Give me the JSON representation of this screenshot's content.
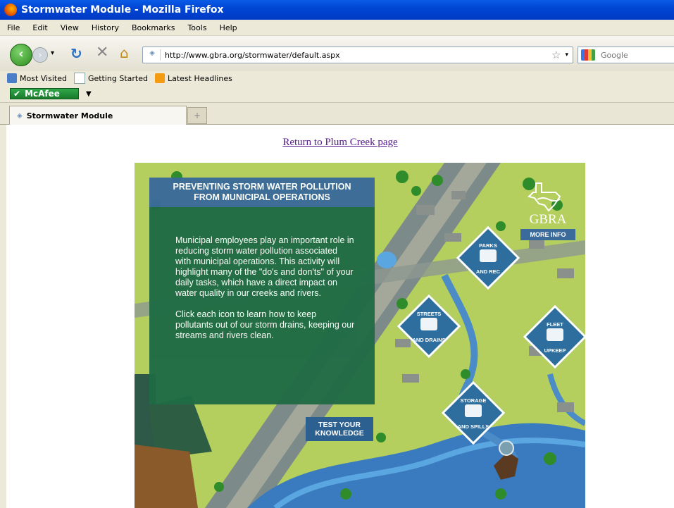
{
  "window": {
    "title": "Stormwater Module - Mozilla Firefox"
  },
  "menu": [
    "File",
    "Edit",
    "View",
    "History",
    "Bookmarks",
    "Tools",
    "Help"
  ],
  "address": {
    "url": "http://www.gbra.org/stormwater/default.aspx"
  },
  "search": {
    "placeholder": "Google"
  },
  "bookmarks": [
    "Most Visited",
    "Getting Started",
    "Latest Headlines"
  ],
  "toolbar": {
    "mcafee_label": "McAfee"
  },
  "tabs": [
    {
      "label": "Stormwater Module"
    }
  ],
  "page": {
    "return_link": "Return to Plum Creek page",
    "info_title_line1": "PREVENTING STORM WATER POLLUTION",
    "info_title_line2": "FROM MUNICIPAL OPERATIONS",
    "info_para1": "Municipal employees play an important role in reducing storm water pollution associated with municipal operations. This activity will highlight many of the \"do's and don'ts\" of your daily tasks, which have a direct impact on water quality in our creeks and rivers.",
    "info_para2": "Click each icon to learn how to keep pollutants out of our storm drains, keeping our streams and rivers clean.",
    "logo_text": "GBRA",
    "more_info": "MORE INFO",
    "icons": [
      {
        "top": "PARKS",
        "bottom": "AND REC"
      },
      {
        "top": "STREETS",
        "bottom": "AND DRAINS"
      },
      {
        "top": "FLEET",
        "bottom": "UPKEEP"
      },
      {
        "top": "STORAGE",
        "bottom": "AND SPILLS"
      }
    ],
    "test_line1": "TEST YOUR",
    "test_line2": "KNOWLEDGE"
  }
}
